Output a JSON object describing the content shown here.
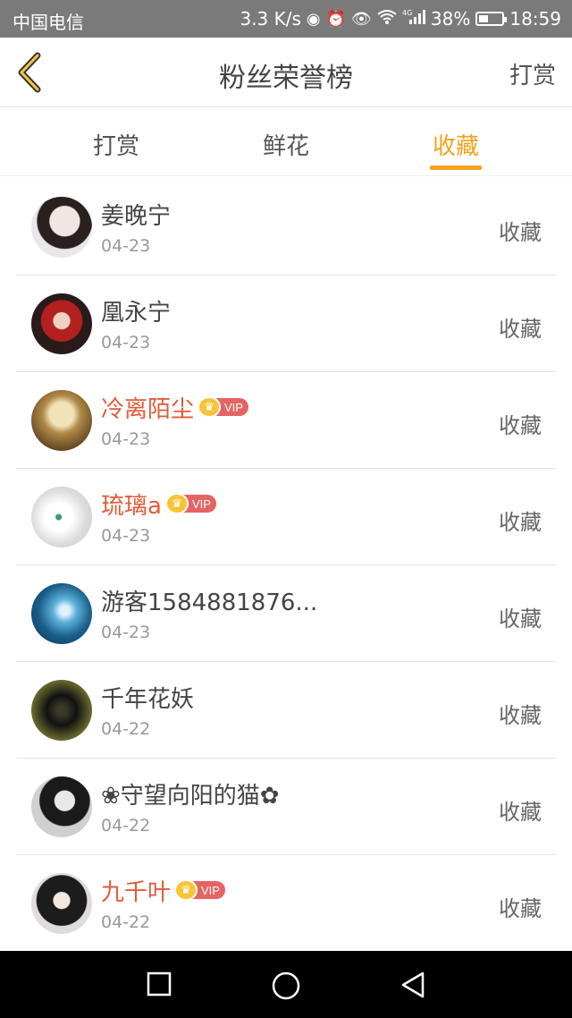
{
  "status_bar": {
    "carrier": "中国电信",
    "speed": "3.3 K/s",
    "network": "4G",
    "battery": "38%",
    "time": "18:59"
  },
  "header": {
    "title": "粉丝荣誉榜",
    "right_action": "打赏"
  },
  "tabs": [
    {
      "label": "打赏",
      "active": false
    },
    {
      "label": "鲜花",
      "active": false
    },
    {
      "label": "收藏",
      "active": true
    }
  ],
  "accent_color": "#f5a21b",
  "vip_name_color": "#e25b3a",
  "vip_label": "VIP",
  "entries": [
    {
      "name": "姜晚宁",
      "date": "04-23",
      "action": "收藏",
      "vip": false
    },
    {
      "name": "凰永宁",
      "date": "04-23",
      "action": "收藏",
      "vip": false
    },
    {
      "name": "冷离陌尘",
      "date": "04-23",
      "action": "收藏",
      "vip": true
    },
    {
      "name": "琉璃a",
      "date": "04-23",
      "action": "收藏",
      "vip": true
    },
    {
      "name": "游客1584881876...",
      "date": "04-23",
      "action": "收藏",
      "vip": false
    },
    {
      "name": "千年花妖",
      "date": "04-22",
      "action": "收藏",
      "vip": false
    },
    {
      "name": "❀守望向阳的猫✿",
      "date": "04-22",
      "action": "收藏",
      "vip": false
    },
    {
      "name": "九千叶",
      "date": "04-22",
      "action": "收藏",
      "vip": true
    }
  ]
}
